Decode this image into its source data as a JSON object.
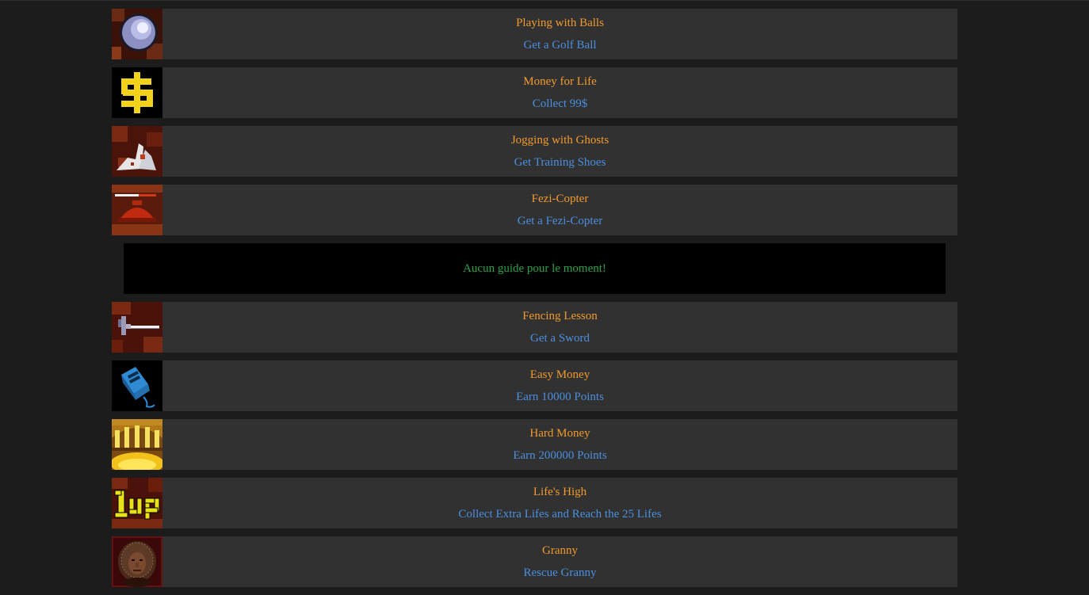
{
  "colors": {
    "page_background": "#1c1c1c",
    "row_background": "#313131",
    "title": "#f39a2d",
    "description": "#4b8fe0",
    "guide_background": "#000000",
    "guide_text": "#2aa34a"
  },
  "achievements_before_guide": [
    {
      "icon": "golf-ball-icon",
      "title": "Playing with Balls",
      "description": "Get a Golf Ball"
    },
    {
      "icon": "dollar-sign-icon",
      "title": "Money for Life",
      "description": "Collect 99$"
    },
    {
      "icon": "training-shoes-icon",
      "title": "Jogging with Ghosts",
      "description": "Get Training Shoes"
    },
    {
      "icon": "fezi-copter-icon",
      "title": "Fezi-Copter",
      "description": "Get a Fezi-Copter"
    }
  ],
  "guide": {
    "text": "Aucun guide pour le moment!"
  },
  "achievements_after_guide": [
    {
      "icon": "sword-icon",
      "title": "Fencing Lesson",
      "description": "Get a Sword"
    },
    {
      "icon": "toaster-icon",
      "title": "Easy Money",
      "description": "Earn 10000 Points"
    },
    {
      "icon": "treasure-room-icon",
      "title": "Hard Money",
      "description": "Earn 200000 Points"
    },
    {
      "icon": "one-up-icon",
      "title": "Life's High",
      "description": "Collect Extra Lifes and Reach the 25 Lifes"
    },
    {
      "icon": "granny-portrait-icon",
      "title": "Granny",
      "description": "Rescue Granny"
    }
  ]
}
